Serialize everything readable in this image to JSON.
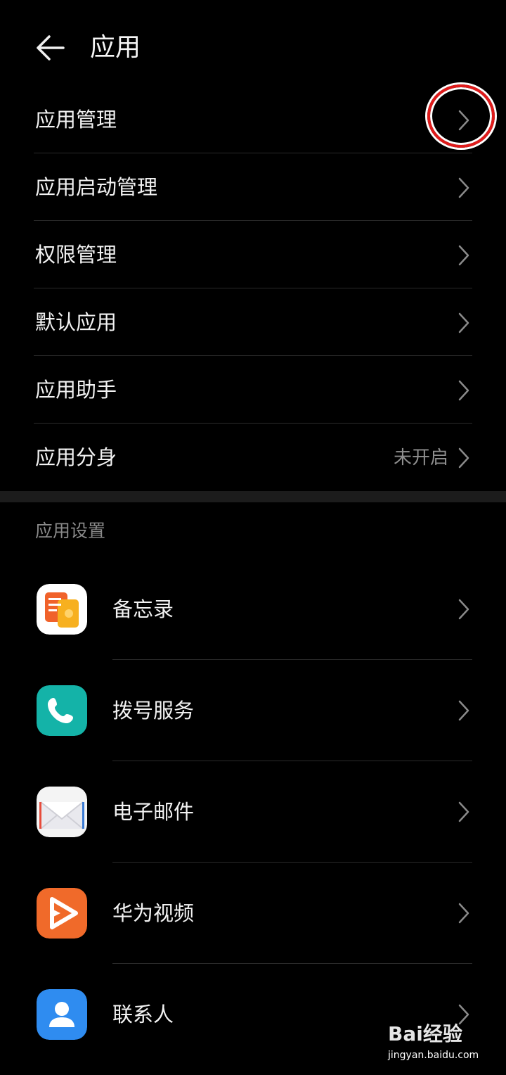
{
  "header": {
    "title": "应用",
    "back_icon": "arrow-left-icon"
  },
  "menu": [
    {
      "label": "应用管理",
      "value": ""
    },
    {
      "label": "应用启动管理",
      "value": ""
    },
    {
      "label": "权限管理",
      "value": ""
    },
    {
      "label": "默认应用",
      "value": ""
    },
    {
      "label": "应用助手",
      "value": ""
    },
    {
      "label": "应用分身",
      "value": "未开启"
    }
  ],
  "app_settings": {
    "section_title": "应用设置",
    "apps": [
      {
        "label": "备忘录",
        "icon": "notepad-app-icon"
      },
      {
        "label": "拨号服务",
        "icon": "phone-app-icon"
      },
      {
        "label": "电子邮件",
        "icon": "email-app-icon"
      },
      {
        "label": "华为视频",
        "icon": "video-app-icon"
      },
      {
        "label": "联系人",
        "icon": "contacts-app-icon"
      }
    ]
  },
  "watermark": {
    "brand": "Bai经验",
    "url": "jingyan.baidu.com"
  },
  "colors": {
    "background": "#000000",
    "divider": "#2a2a2a",
    "highlight": "#e01b1b",
    "secondary_text": "#8e8e8e"
  }
}
